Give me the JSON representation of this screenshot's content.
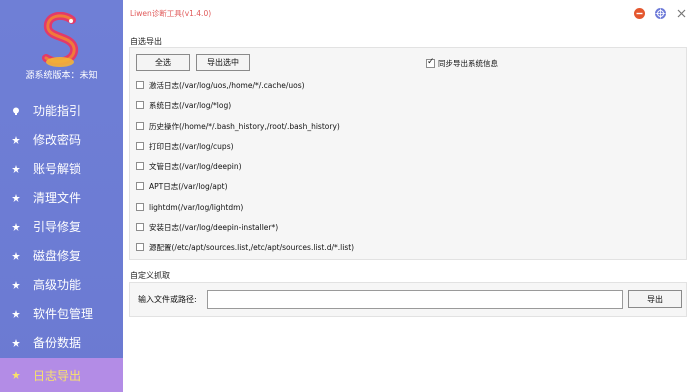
{
  "app": {
    "title": "Liwen诊断工具(v1.4.0)",
    "window_buttons": [
      "minimize-icon",
      "help-icon",
      "close-icon"
    ]
  },
  "sidebar": {
    "source_version": "源系统版本：未知",
    "items": [
      {
        "label": "功能指引",
        "icon": "lightbulb-icon"
      },
      {
        "label": "修改密码",
        "icon": "star-icon"
      },
      {
        "label": "账号解锁",
        "icon": "star-icon"
      },
      {
        "label": "清理文件",
        "icon": "star-icon"
      },
      {
        "label": "引导修复",
        "icon": "star-icon"
      },
      {
        "label": "磁盘修复",
        "icon": "star-icon"
      },
      {
        "label": "高级功能",
        "icon": "star-icon"
      },
      {
        "label": "软件包管理",
        "icon": "star-icon"
      },
      {
        "label": "备份数据",
        "icon": "star-icon"
      },
      {
        "label": "日志导出",
        "icon": "star-icon",
        "active": true
      }
    ]
  },
  "export_section": {
    "title": "自选导出",
    "select_all_label": "全选",
    "export_selected_label": "导出选中",
    "sync_label": "同步导出系统信息",
    "sync_checked": true,
    "options": [
      {
        "label": "激活日志(/var/log/uos,/home/*/.cache/uos)",
        "checked": false
      },
      {
        "label": "系统日志(/var/log/*log)",
        "checked": false
      },
      {
        "label": "历史操作(/home/*/.bash_history,/root/.bash_history)",
        "checked": false
      },
      {
        "label": "打印日志(/var/log/cups)",
        "checked": false
      },
      {
        "label": "文管日志(/var/log/deepin)",
        "checked": false
      },
      {
        "label": "APT日志(/var/log/apt)",
        "checked": false
      },
      {
        "label": "lightdm(/var/log/lightdm)",
        "checked": false
      },
      {
        "label": "安装日志(/var/log/deepin-installer*)",
        "checked": false
      },
      {
        "label": "源配置(/etc/apt/sources.list,/etc/apt/sources.list.d/*.list)",
        "checked": false
      }
    ]
  },
  "custom_section": {
    "title": "自定义抓取",
    "path_label": "输入文件或路径:",
    "path_value": "",
    "export_label": "导出"
  },
  "colors": {
    "sidebar_bg": "#6f7fd6",
    "active_item_bg": "#b38ce6",
    "active_item_text": "#f8e26a",
    "title_red": "#e05a5a"
  }
}
